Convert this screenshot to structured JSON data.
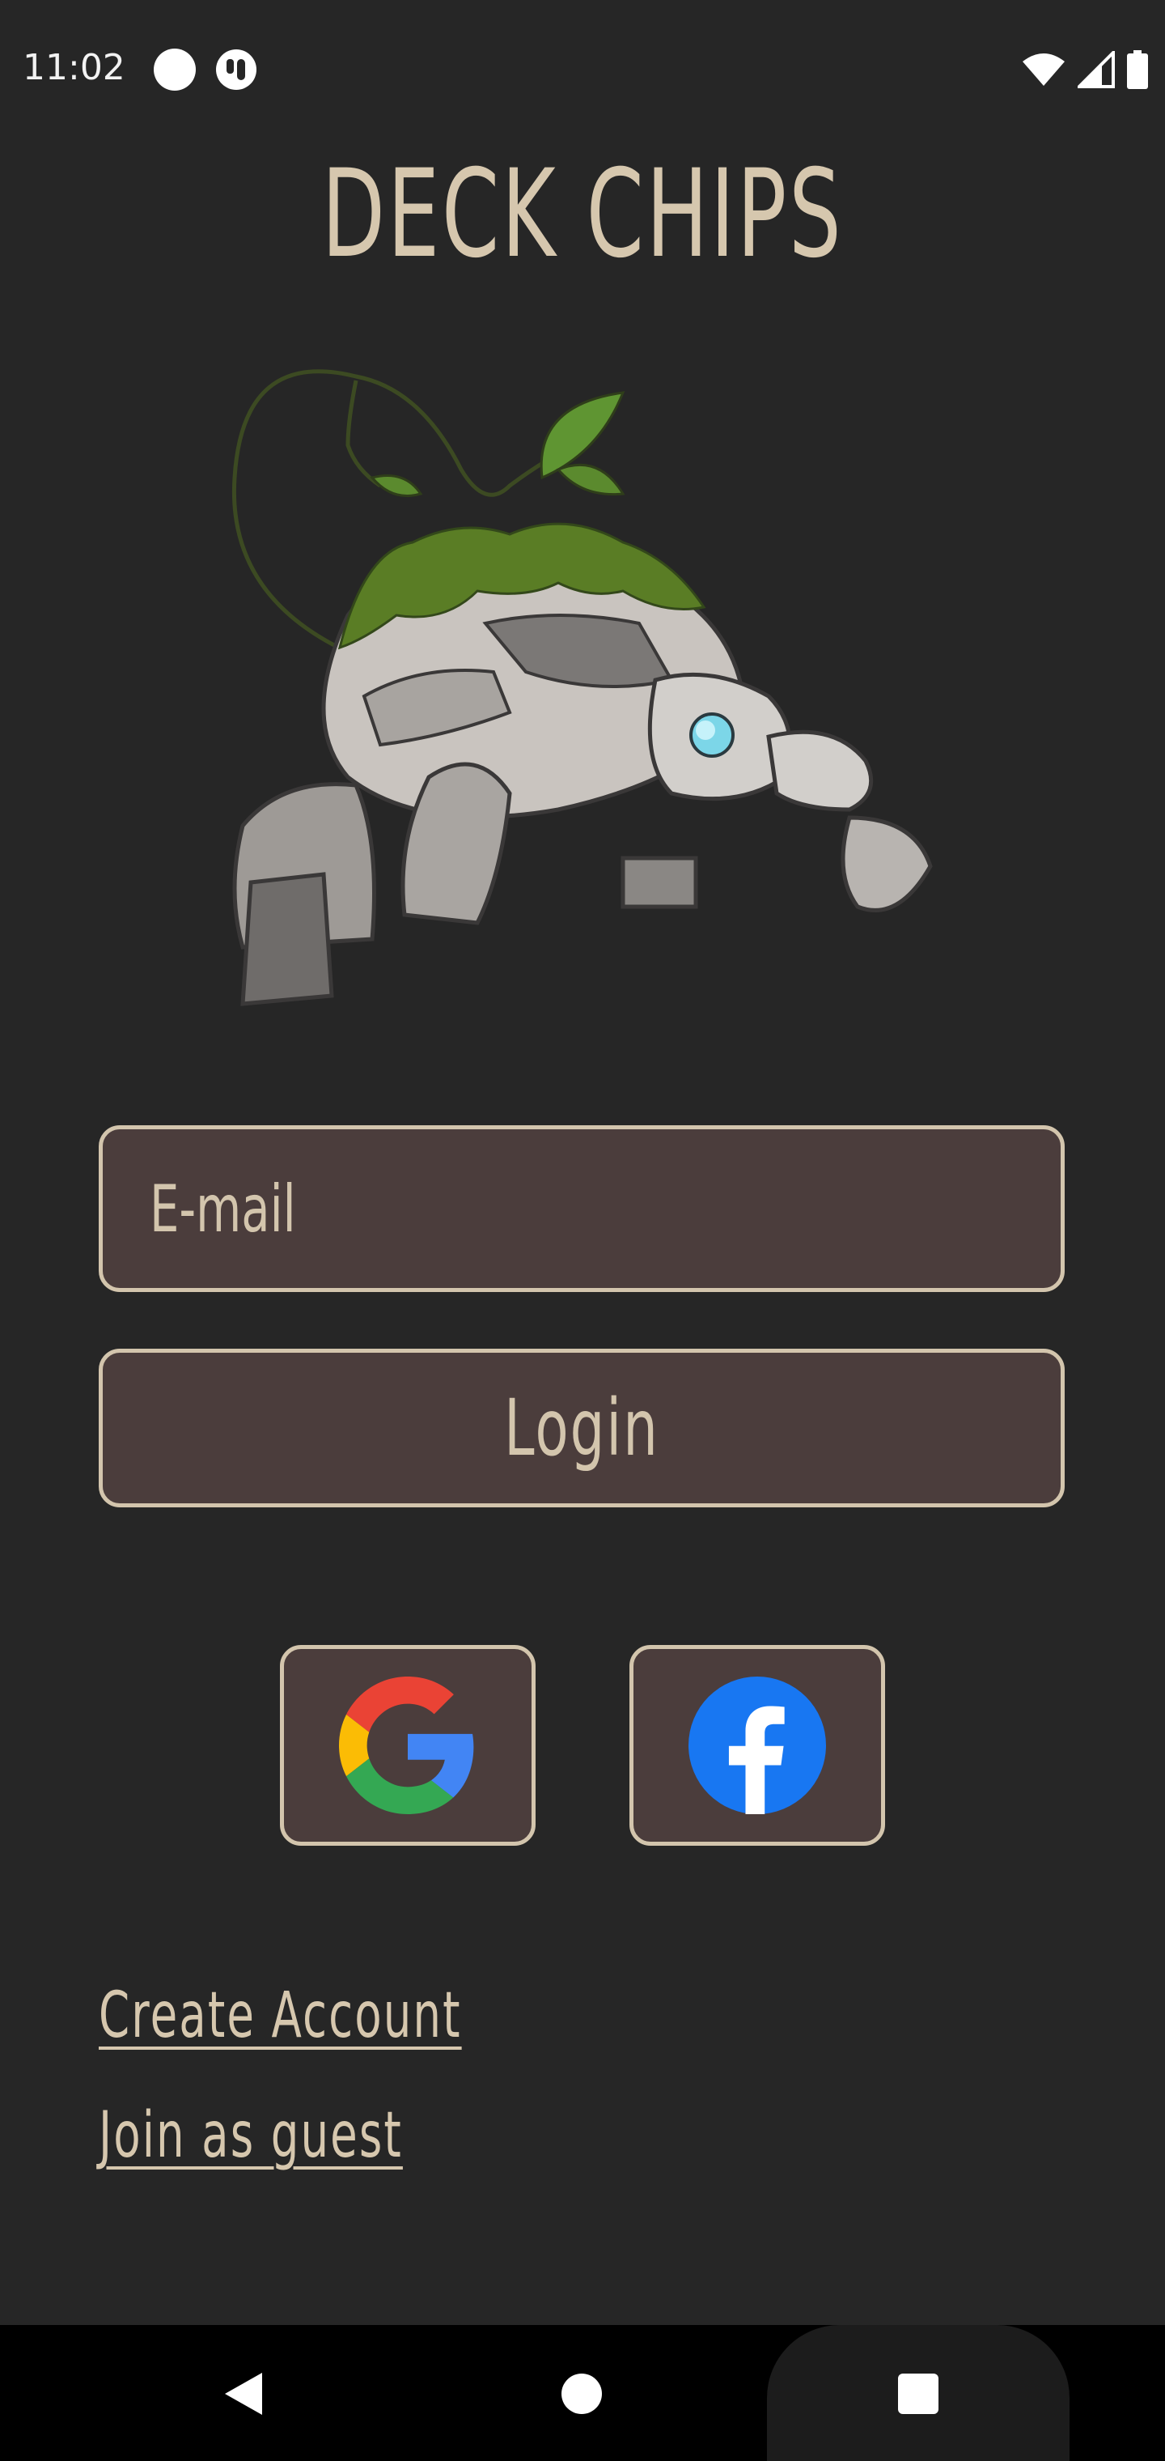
{
  "status_bar": {
    "time": "11:02",
    "icons": [
      "circle-notification-icon",
      "app-notification-icon",
      "wifi-icon",
      "cellular-signal-icon",
      "battery-icon"
    ]
  },
  "app": {
    "title": "DECK CHIPS",
    "mascot": "rock-turtle-mascot"
  },
  "login_form": {
    "email_placeholder": "E-mail",
    "email_value": "",
    "login_label": "Login"
  },
  "social": {
    "google": "google-icon",
    "facebook": "facebook-icon"
  },
  "links": {
    "create_account": "Create Account",
    "join_guest": "Join as guest"
  },
  "nav_bar": {
    "icons": [
      "back-icon",
      "home-icon",
      "recents-icon"
    ]
  },
  "colors": {
    "background": "#262626",
    "accent_text": "#d6c7ae",
    "field_background": "#4b3d3c",
    "field_border": "#d3c5ad"
  }
}
